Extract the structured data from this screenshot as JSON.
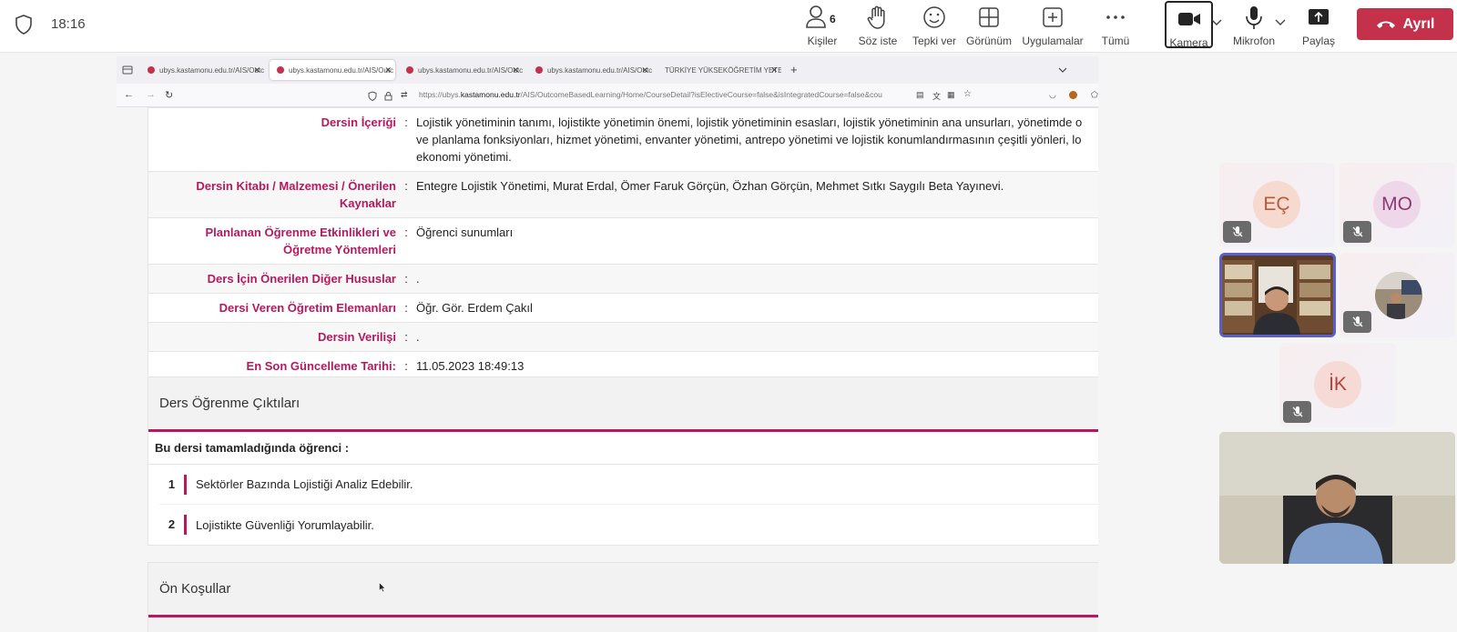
{
  "meeting": {
    "time": "18:16",
    "people_count": "6",
    "buttons": {
      "people": "Kişiler",
      "raise_hand": "Söz iste",
      "react": "Tepki ver",
      "view": "Görünüm",
      "apps": "Uygulamalar",
      "more": "Tümü",
      "camera": "Kamera",
      "mic": "Mikrofon",
      "share": "Paylaş",
      "leave": "Ayrıl"
    },
    "colors": {
      "leave": "#c4314b",
      "accent": "#b5195e",
      "self_frame": "#5b5fc7"
    }
  },
  "browser": {
    "tabs": [
      {
        "label": "ubys.kastamonu.edu.tr/AIS/Outc"
      },
      {
        "label": "ubys.kastamonu.edu.tr/AIS/Outc"
      },
      {
        "label": "ubys.kastamonu.edu.tr/AIS/Outc"
      },
      {
        "label": "ubys.kastamonu.edu.tr/AIS/Outc"
      },
      {
        "label": "TÜRKİYE YÜKSEKÖĞRETİM YETERL"
      }
    ],
    "url_prefix": "https://ubys.",
    "url_domain": "kastamonu.edu.tr",
    "url_rest": "/AIS/OutcomeBasedLearning/Home/CourseDetail?isElectiveCourse=false&isIntegratedCourse=false&cou"
  },
  "course": {
    "rows": [
      {
        "key": "Dersin İçeriği",
        "value": "Lojistik yönetiminin tanımı, lojistikte yönetimin önemi, lojistik yönetiminin esasları, lojistik yönetiminin ana unsurları, yönetimde o\nve planlama fonksiyonları, hizmet yönetimi, envanter yönetimi, antrepo yönetimi ve lojistik konumlandırmasının çeşitli yönleri, lo\nekonomi yönetimi."
      },
      {
        "key": "Dersin Kitabı / Malzemesi / Önerilen\nKaynaklar",
        "value": "Entegre Lojistik Yönetimi, Murat Erdal, Ömer Faruk Görçün, Özhan Görçün, Mehmet Sıtkı Saygılı Beta Yayınevi."
      },
      {
        "key": "Planlanan Öğrenme Etkinlikleri ve\nÖğretme Yöntemleri",
        "value": "Öğrenci sunumları"
      },
      {
        "key": "Ders İçin Önerilen Diğer Hususlar",
        "value": "."
      },
      {
        "key": "Dersi Veren Öğretim Elemanları",
        "value": "Öğr. Gör. Erdem Çakıl"
      },
      {
        "key": "Dersin Verilişi",
        "value": "."
      },
      {
        "key": "En Son Güncelleme Tarihi:",
        "value": "11.05.2023 18:49:13"
      }
    ],
    "colon": ":",
    "outcomes_title": "Ders Öğrenme Çıktıları",
    "outcomes_intro": "Bu dersi tamamladığında öğrenci :",
    "outcomes": [
      {
        "num": "1",
        "text": "Sektörler Bazında Lojistiği Analiz Edebilir."
      },
      {
        "num": "2",
        "text": "Lojistikte Güvenliği Yorumlayabilir."
      }
    ],
    "prereq_title": "Ön Koşullar"
  },
  "participants": [
    {
      "initials": "EÇ",
      "color": "#b75a3a",
      "bg": "#f6d9cf",
      "muted": true
    },
    {
      "initials": "MO",
      "color": "#8c3a73",
      "bg": "#efd7ea",
      "muted": true
    },
    {
      "initials": "İK",
      "color": "#b5423a",
      "bg": "#f6dad5",
      "muted": true
    }
  ]
}
